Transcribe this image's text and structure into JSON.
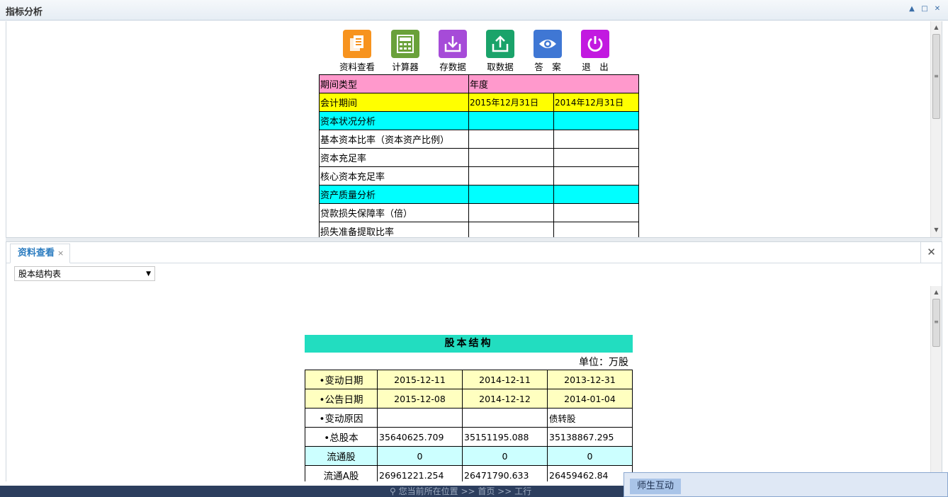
{
  "window": {
    "title": "指标分析",
    "controls": {
      "min": "▲",
      "max": "□",
      "close": "✕"
    }
  },
  "toolbar": [
    {
      "label": "资料查看",
      "icon": "document-view-icon",
      "color": "#f7931e"
    },
    {
      "label": "计算器",
      "icon": "calculator-icon",
      "color": "#6aa13a"
    },
    {
      "label": "存数据",
      "icon": "save-data-icon",
      "color": "#a64bd8"
    },
    {
      "label": "取数据",
      "icon": "load-data-icon",
      "color": "#1aa36a"
    },
    {
      "label": "答　案",
      "icon": "eye-icon",
      "color": "#3f77d4"
    },
    {
      "label": "退　出",
      "icon": "power-icon",
      "color": "#c219e0"
    }
  ],
  "indicator_table": {
    "period_type_label": "期间类型",
    "period_type_value": "年度",
    "accounting_period_label": "会计期间",
    "periods": [
      "2015年12月31日",
      "2014年12月31日"
    ],
    "rows": [
      {
        "label": "资本状况分析",
        "style": "cyan"
      },
      {
        "label": "基本资本比率（资本资产比例）",
        "style": "white"
      },
      {
        "label": "资本充足率",
        "style": "white"
      },
      {
        "label": "核心资本充足率",
        "style": "white"
      },
      {
        "label": "资产质量分析",
        "style": "cyan"
      },
      {
        "label": "贷款损失保障率（倍）",
        "style": "white"
      },
      {
        "label": "损失准备提取比率",
        "style": "white"
      }
    ]
  },
  "tabs": [
    {
      "label": "资料查看",
      "close": "×"
    }
  ],
  "close_all": "✕",
  "dropdown": {
    "value": "股本结构表",
    "caret": "▼"
  },
  "structure": {
    "title": "股本结构",
    "unit": "单位：万股",
    "rows": [
      {
        "label": "•变动日期",
        "style": "yellow",
        "align": "ctr",
        "values": [
          "2015-12-11",
          "2014-12-11",
          "2013-12-31"
        ]
      },
      {
        "label": "•公告日期",
        "style": "yellow",
        "align": "ctr",
        "values": [
          "2015-12-08",
          "2014-12-12",
          "2014-01-04"
        ]
      },
      {
        "label": "•变动原因",
        "style": "white",
        "align": "lft",
        "values": [
          "",
          "",
          "债转股"
        ]
      },
      {
        "label": "•总股本",
        "style": "white",
        "align": "lft",
        "values": [
          "35640625.709",
          "35151195.088",
          "35138867.295"
        ]
      },
      {
        "label": "流通股",
        "style": "cyan",
        "align": "ctr",
        "values": [
          "0",
          "0",
          "0"
        ]
      },
      {
        "label": "流通A股",
        "style": "white",
        "align": "lft",
        "values": [
          "26961221.254",
          "26471790.633",
          "26459462.84"
        ]
      }
    ]
  },
  "bottom": {
    "location": "您当前所在位置 >> 首页 >> 工行",
    "location_icon": "location-pin-icon"
  },
  "chat": {
    "label": "师生互动"
  }
}
